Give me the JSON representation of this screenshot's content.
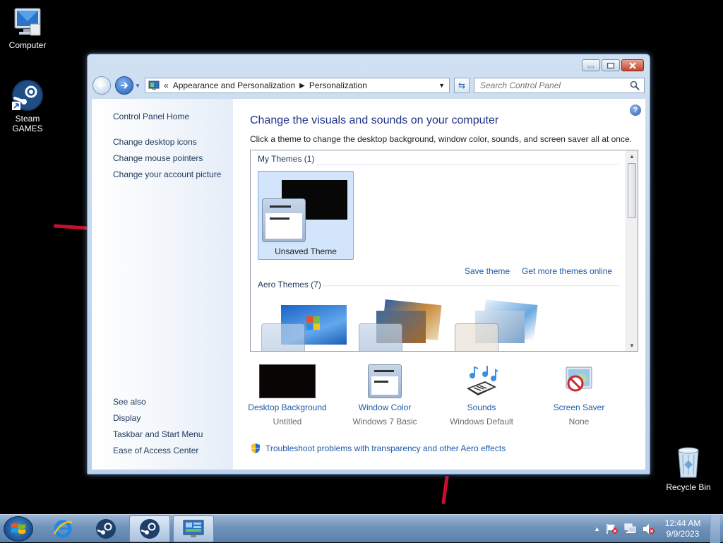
{
  "desktop": {
    "icons": [
      {
        "label": "Computer"
      },
      {
        "label": "Steam\nGAMES",
        "line1": "Steam",
        "line2": "GAMES"
      },
      {
        "label": "Recycle Bin"
      }
    ]
  },
  "window": {
    "address": {
      "overflow_chevron": "«",
      "crumb1": "Appearance and Personalization",
      "crumb2": "Personalization"
    },
    "search": {
      "placeholder": "Search Control Panel"
    },
    "left_nav": {
      "home": "Control Panel Home",
      "links": [
        "Change desktop icons",
        "Change mouse pointers",
        "Change your account picture"
      ],
      "see_also_label": "See also",
      "see_also": [
        "Display",
        "Taskbar and Start Menu",
        "Ease of Access Center"
      ]
    },
    "main": {
      "title": "Change the visuals and sounds on your computer",
      "description": "Click a theme to change the desktop background, window color, sounds, and screen saver all at once.",
      "my_themes_header": "My Themes (1)",
      "unsaved_theme_label": "Unsaved Theme",
      "save_theme": "Save theme",
      "get_more": "Get more themes online",
      "aero_header": "Aero Themes (7)"
    },
    "bottom": [
      {
        "caption": "Desktop Background",
        "sub": "Untitled"
      },
      {
        "caption": "Window Color",
        "sub": "Windows 7 Basic"
      },
      {
        "caption": "Sounds",
        "sub": "Windows Default"
      },
      {
        "caption": "Screen Saver",
        "sub": "None"
      }
    ],
    "troubleshoot": "Troubleshoot problems with transparency and other Aero effects"
  },
  "taskbar": {
    "clock": {
      "time": "12:44 AM",
      "date": "9/9/2023"
    }
  },
  "colors": {
    "link": "#1e5aa8",
    "title": "#1e3287",
    "selected_tile": "#d3e5fb"
  }
}
